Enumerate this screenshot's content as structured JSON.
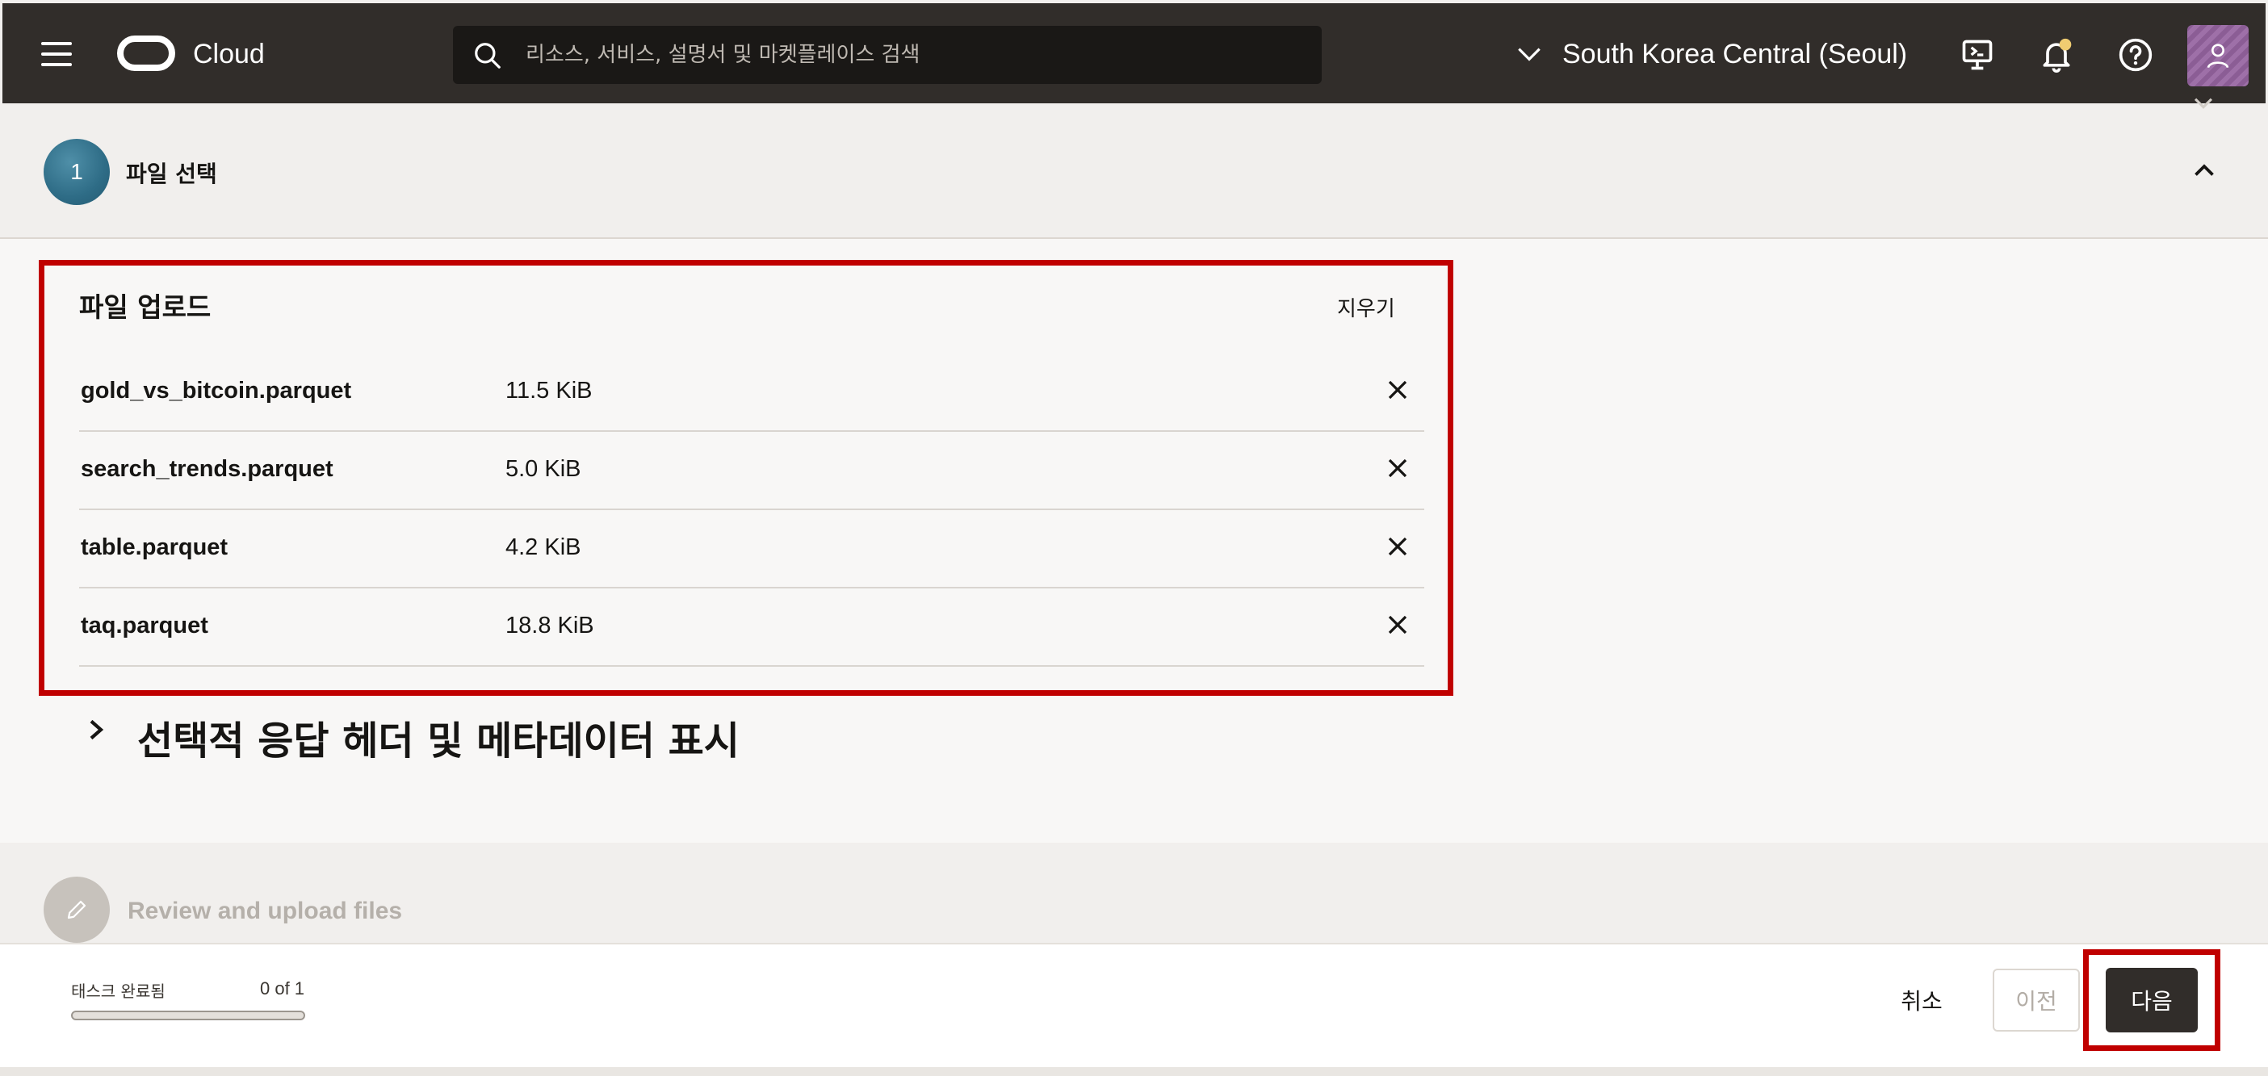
{
  "header": {
    "brand": "Cloud",
    "search": {
      "placeholder": "리소스, 서비스, 설명서 및 마켓플레이스 검색",
      "value": ""
    },
    "region": "South Korea Central (Seoul)",
    "icons": [
      "menu-icon",
      "oracle-logo",
      "search-icon",
      "chevron-down-icon",
      "cloud-shell-icon",
      "bell-icon",
      "help-icon",
      "user-avatar-icon"
    ],
    "notification_dot_color": "#f0cc71",
    "bar_color": "#312d2a"
  },
  "step1": {
    "number": "1",
    "title": "파일 선택",
    "upload": {
      "title": "파일 업로드",
      "clear_label": "지우기",
      "files": [
        {
          "name": "gold_vs_bitcoin.parquet",
          "size": "11.5 KiB"
        },
        {
          "name": "search_trends.parquet",
          "size": "5.0 KiB"
        },
        {
          "name": "table.parquet",
          "size": "4.2 KiB"
        },
        {
          "name": "taq.parquet",
          "size": "18.8 KiB"
        }
      ]
    },
    "optional_section": "선택적 응답 헤더 및 메타데이터 표시"
  },
  "step2": {
    "title": "Review and upload files"
  },
  "footer": {
    "task_label": "태스크 완료됨",
    "task_count": "0 of 1",
    "progress_fraction": 0,
    "cancel_label": "취소",
    "prev_label": "이전",
    "next_label": "다음"
  },
  "highlight_color": "#c00000"
}
